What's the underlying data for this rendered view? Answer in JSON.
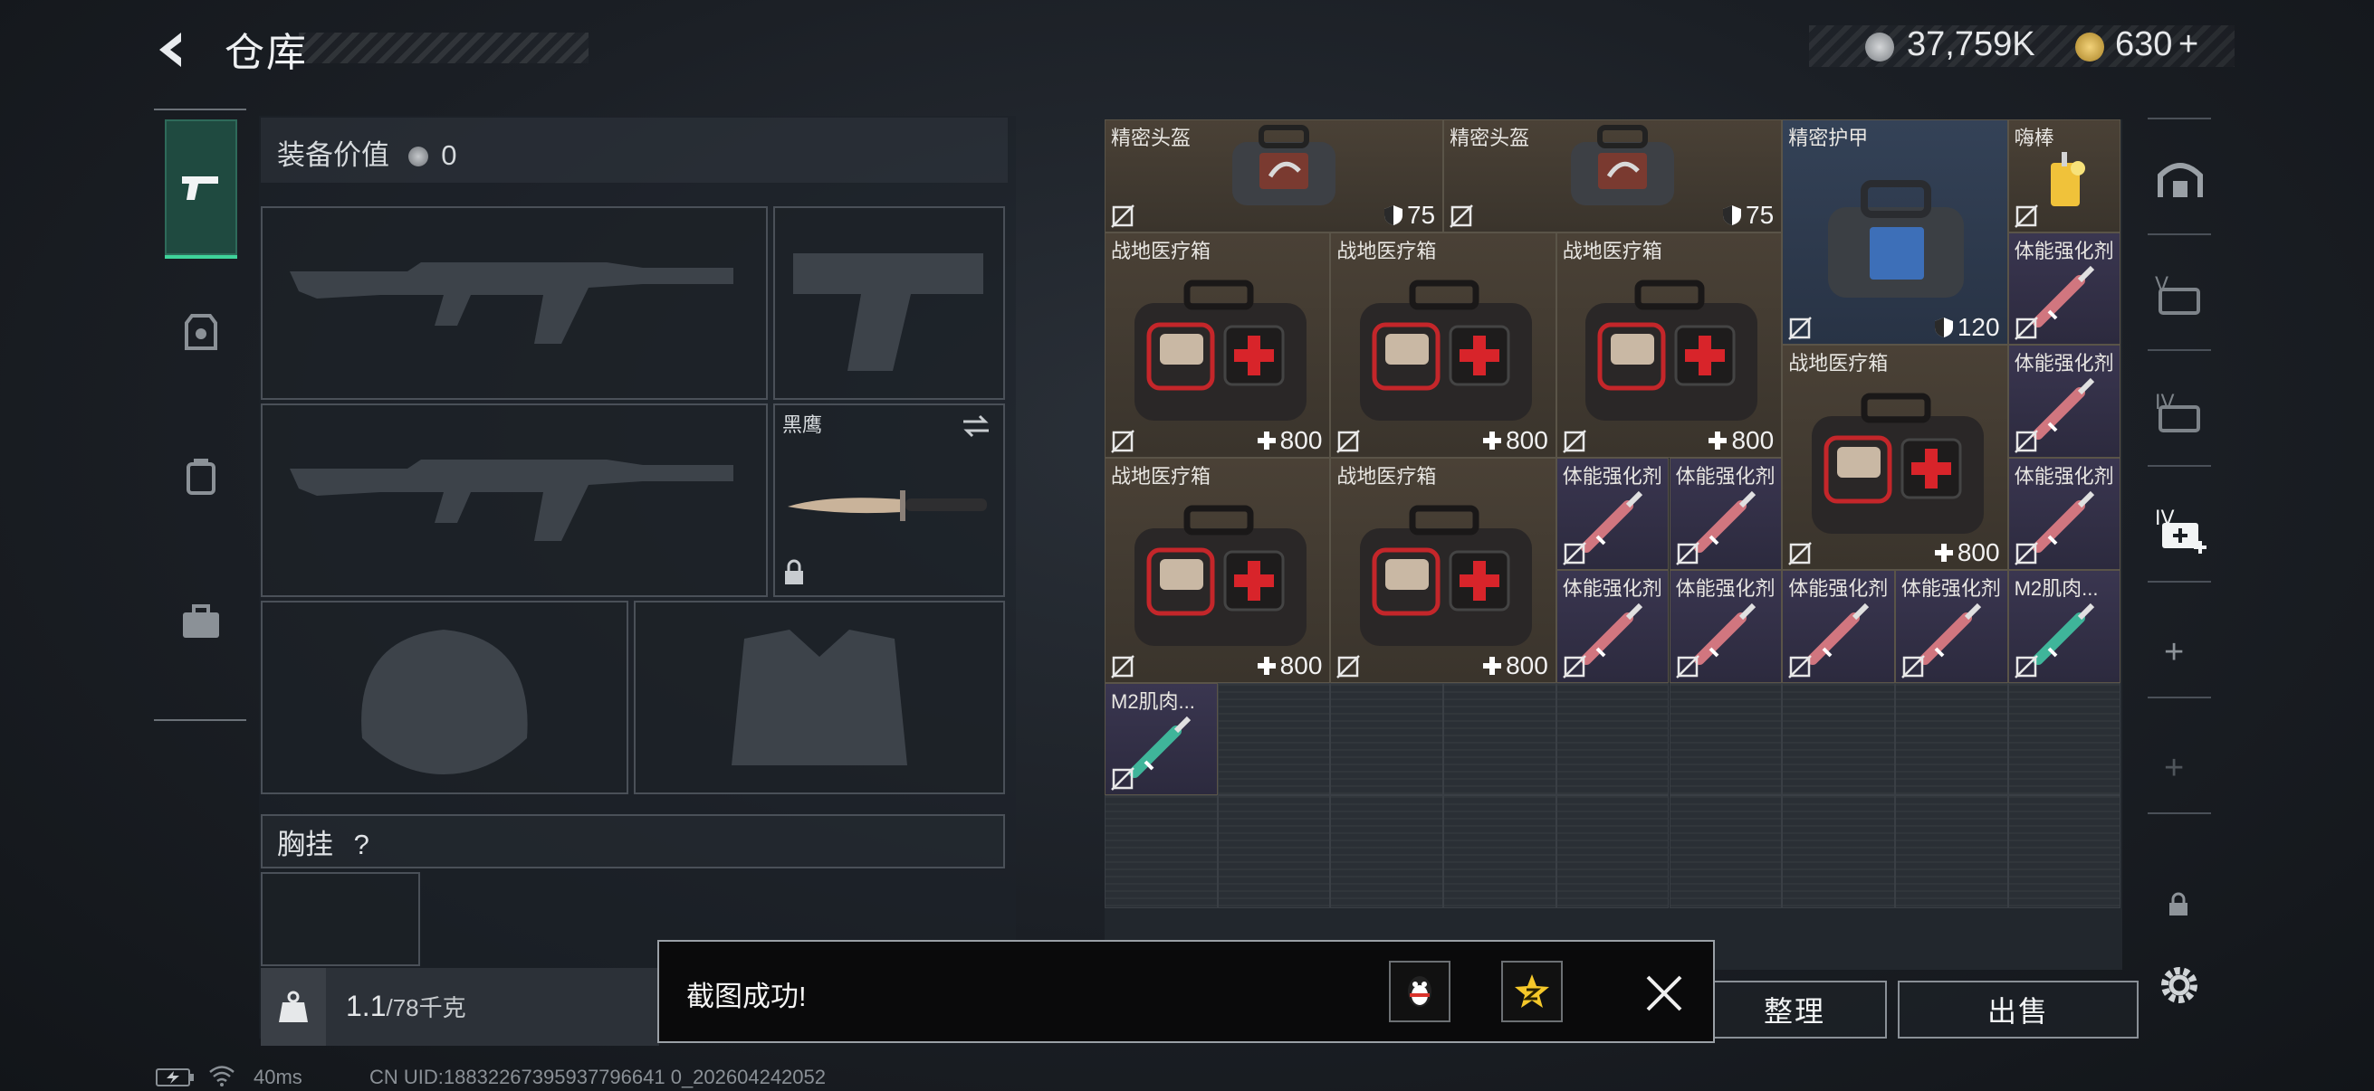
{
  "header": {
    "title": "仓库",
    "currency1": "37,759K",
    "currency2": "630",
    "plus": "+"
  },
  "equipment": {
    "label": "装备价值",
    "value": "0",
    "knife_name": "黑鹰",
    "chest_label": "胸挂",
    "chest_help": "?"
  },
  "weight": {
    "current": "1.1",
    "max": "/78千克"
  },
  "inventory": {
    "items": [
      {
        "name": "精密头盔",
        "value": "75"
      },
      {
        "name": "精密头盔",
        "value": "75"
      },
      {
        "name": "精密护甲",
        "value": "120"
      },
      {
        "name": "嗨棒",
        "value": ""
      },
      {
        "name": "战地医疗箱",
        "value": "800"
      },
      {
        "name": "战地医疗箱",
        "value": "800"
      },
      {
        "name": "战地医疗箱",
        "value": "800"
      },
      {
        "name": "体能强化剂",
        "value": ""
      },
      {
        "name": "战地医疗箱",
        "value": "800"
      },
      {
        "name": "体能强化剂",
        "value": ""
      },
      {
        "name": "战地医疗箱",
        "value": "800"
      },
      {
        "name": "战地医疗箱",
        "value": "800"
      },
      {
        "name": "体能强化剂",
        "value": ""
      },
      {
        "name": "体能强化剂",
        "value": ""
      },
      {
        "name": "体能强化剂",
        "value": ""
      },
      {
        "name": "体能强化剂",
        "value": ""
      },
      {
        "name": "体能强化剂",
        "value": ""
      },
      {
        "name": "体能强化剂",
        "value": ""
      },
      {
        "name": "体能强化剂",
        "value": ""
      },
      {
        "name": "M2肌肉...",
        "value": ""
      },
      {
        "name": "M2肌肉...",
        "value": ""
      }
    ]
  },
  "buttons": {
    "sort": "整理",
    "sell": "出售"
  },
  "toast": {
    "message": "截图成功!"
  },
  "status": {
    "ping": "40ms",
    "uid": "CN UID:18832267395937796641 0_202604242052"
  },
  "colors": {
    "accent": "#3fd39a",
    "rare_purple": "#3a3650",
    "rare_brown": "#4a4136"
  }
}
